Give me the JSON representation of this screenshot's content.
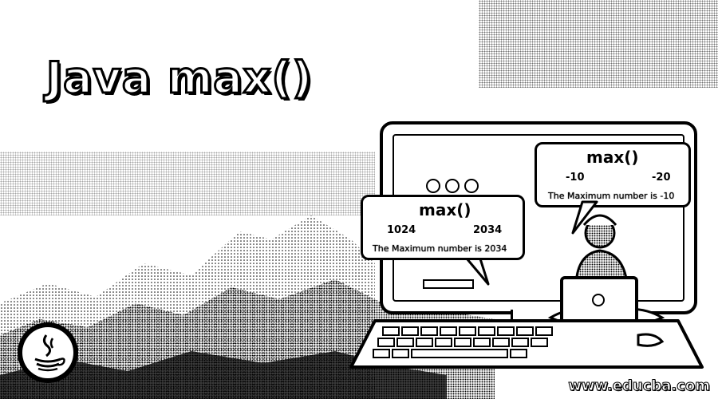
{
  "title": "Java max()",
  "bubble_right": {
    "heading": "max()",
    "num_a": "-10",
    "num_b": "-20",
    "result": "The Maximum number is -10"
  },
  "bubble_left": {
    "heading": "max()",
    "num_a": "1024",
    "num_b": "2034",
    "result": "The Maximum number is 2034"
  },
  "watermark": "www.educba.com",
  "icons": [
    "java-logo-icon",
    "laptop-icon",
    "window-dots-icon"
  ]
}
